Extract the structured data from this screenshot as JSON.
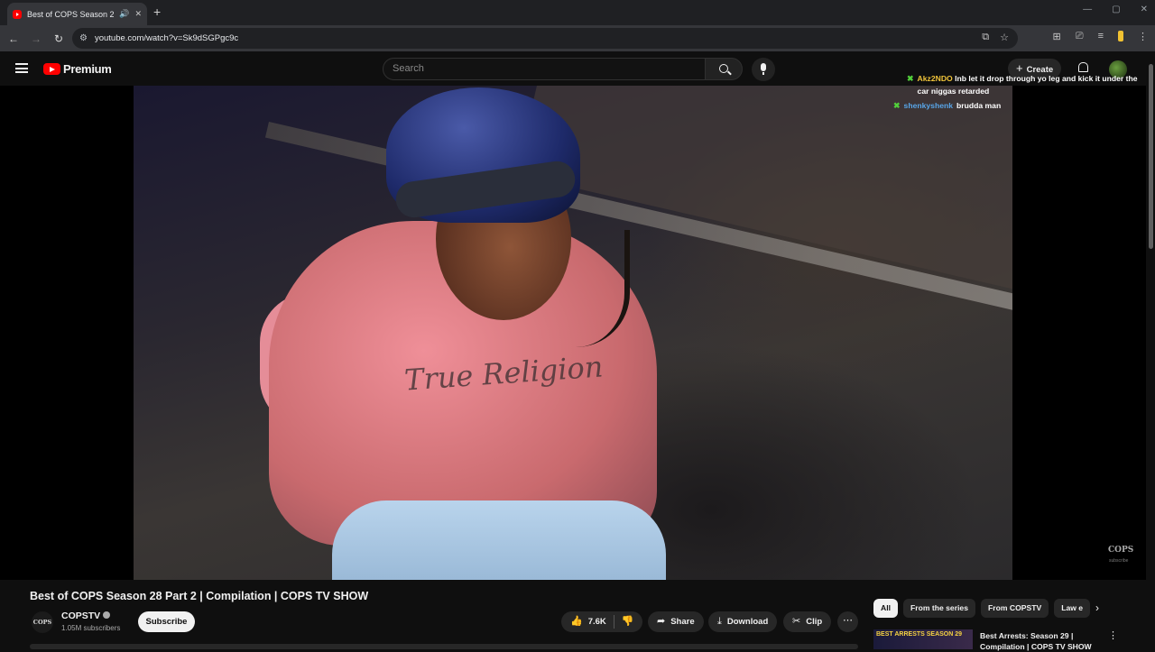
{
  "browser": {
    "tab_title": "Best of COPS Season 28 Pa",
    "url": "youtube.com/watch?v=Sk9dSGPgc9c"
  },
  "header": {
    "logo_text": "Premium",
    "search_placeholder": "Search",
    "create_label": "Create"
  },
  "chat": [
    {
      "user": "Akz2NDO",
      "message": "lnb let it drop through yo leg and kick it under the car niggas retarded"
    },
    {
      "user": "shenkyshenk",
      "message": "brudda man"
    }
  ],
  "video": {
    "shirt_text": "True Religion",
    "watermark": "COPS",
    "watermark_sub": "subscribe"
  },
  "below": {
    "title": "Best of COPS Season 28 Part 2 | Compilation | COPS TV SHOW",
    "channel_avatar": "COPS",
    "channel_name": "COPSTV",
    "subscribers": "1.05M subscribers",
    "subscribe_label": "Subscribe",
    "like_count": "7.6K",
    "share_label": "Share",
    "download_label": "Download",
    "clip_label": "Clip"
  },
  "chips": [
    "All",
    "From the series",
    "From COPSTV",
    "Law e"
  ],
  "recommendation": {
    "thumb_text": "BEST ARRESTS SEASON 29",
    "title": "Best Arrests: Season 29 | Compilation | COPS TV SHOW"
  },
  "colors": {
    "background": "#0f0f0f",
    "brand_red": "#ff0000",
    "chat_user_a": "#f0c43a",
    "chat_user_b": "#58a5e8",
    "chat_badge": "#52d13b"
  }
}
